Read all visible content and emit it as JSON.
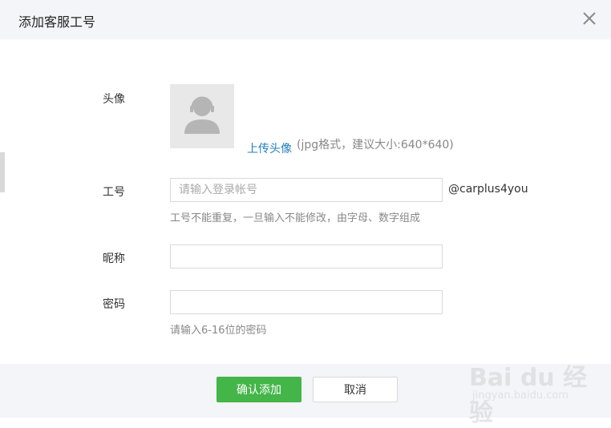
{
  "dialog": {
    "title": "添加客服工号",
    "close_icon": "close-icon"
  },
  "form": {
    "avatar": {
      "label": "头像",
      "placeholder_icon": "user-headset-icon",
      "upload_link": "上传头像",
      "upload_hint": "(jpg格式，建议大小:640*640)"
    },
    "account": {
      "label": "工号",
      "placeholder": "请输入登录帐号",
      "value": "",
      "suffix": "@carplus4you",
      "hint": "工号不能重复，一旦输入不能修改，由字母、数字组成"
    },
    "nickname": {
      "label": "昵称",
      "value": ""
    },
    "password": {
      "label": "密码",
      "value": "",
      "hint": "请输入6-16位的密码"
    }
  },
  "footer": {
    "confirm_label": "确认添加",
    "cancel_label": "取消"
  },
  "watermark": {
    "logo_text": "Bai du 经验",
    "sub_text": "jingyan.baidu.com"
  },
  "colors": {
    "accent_green": "#44b549",
    "link_blue": "#1f7fc2",
    "header_bg": "#f4f5f9"
  }
}
